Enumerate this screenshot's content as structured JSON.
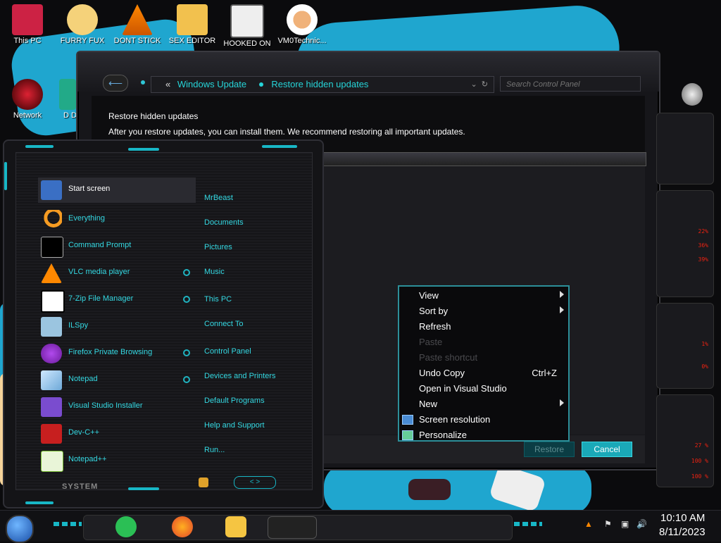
{
  "desktop": {
    "icons": [
      {
        "label": "This PC",
        "icon": "this-pc-icon"
      },
      {
        "label": "FURRY FUX",
        "icon": "cartoon-icon"
      },
      {
        "label": "DONT STICK",
        "icon": "vlc-cone-icon"
      },
      {
        "label": "SEX EDITOR",
        "icon": "hxd-editor-icon"
      },
      {
        "label": "HOOKED ON",
        "icon": "maze-app-icon"
      },
      {
        "label": "VM0Technic...",
        "icon": "doctor-user-icon"
      },
      {
        "label": "Network",
        "icon": "network-icon"
      },
      {
        "label": "D DUM",
        "icon": "partial-icon"
      }
    ]
  },
  "control_panel": {
    "breadcrumb": [
      "Windows Update",
      "Restore hidden updates"
    ],
    "breadcrumb_prefix": "«",
    "search_placeholder": "Search Control Panel",
    "heading": "Restore hidden updates",
    "description": "After you restore updates, you can install them. We recommend restoring all important updates.",
    "buttons": {
      "restore": "Restore",
      "cancel": "Cancel"
    }
  },
  "start_menu": {
    "programs": [
      {
        "label": "Start screen",
        "icon": "start-screen-icon",
        "selected": true,
        "has_jump": false
      },
      {
        "label": "Everything",
        "icon": "magnifier-icon",
        "selected": false,
        "has_jump": false
      },
      {
        "label": "Command Prompt",
        "icon": "cmd-icon",
        "selected": false,
        "has_jump": false
      },
      {
        "label": "VLC media player",
        "icon": "vlc-icon",
        "selected": false,
        "has_jump": true
      },
      {
        "label": "7-Zip File Manager",
        "icon": "7zip-icon",
        "selected": false,
        "has_jump": true
      },
      {
        "label": "ILSpy",
        "icon": "ilspy-icon",
        "selected": false,
        "has_jump": false
      },
      {
        "label": "Firefox Private Browsing",
        "icon": "firefox-private-icon",
        "selected": false,
        "has_jump": true
      },
      {
        "label": "Notepad",
        "icon": "notepad-icon",
        "selected": false,
        "has_jump": true
      },
      {
        "label": "Visual Studio Installer",
        "icon": "vs-installer-icon",
        "selected": false,
        "has_jump": false
      },
      {
        "label": "Dev-C++",
        "icon": "devcpp-icon",
        "selected": false,
        "has_jump": false
      },
      {
        "label": "Notepad++",
        "icon": "notepadpp-icon",
        "selected": false,
        "has_jump": false
      }
    ],
    "places": [
      "MrBeast",
      "Documents",
      "Pictures",
      "Music",
      "This PC",
      "Connect To",
      "Control Panel",
      "Devices and Printers",
      "Default Programs",
      "Help and Support",
      "Run..."
    ],
    "footer_label": "SYSTEM",
    "nav_arrows": "< >"
  },
  "context_menu": {
    "items": [
      {
        "label": "View",
        "shortcut": "",
        "submenu": true,
        "disabled": false,
        "icon": ""
      },
      {
        "label": "Sort by",
        "shortcut": "",
        "submenu": true,
        "disabled": false,
        "icon": ""
      },
      {
        "label": "Refresh",
        "shortcut": "",
        "submenu": false,
        "disabled": false,
        "icon": ""
      },
      {
        "label": "Paste",
        "shortcut": "",
        "submenu": false,
        "disabled": true,
        "icon": ""
      },
      {
        "label": "Paste shortcut",
        "shortcut": "",
        "submenu": false,
        "disabled": true,
        "icon": ""
      },
      {
        "label": "Undo Copy",
        "shortcut": "Ctrl+Z",
        "submenu": false,
        "disabled": false,
        "icon": ""
      },
      {
        "label": "Open in Visual Studio",
        "shortcut": "",
        "submenu": false,
        "disabled": false,
        "icon": ""
      },
      {
        "label": "New",
        "shortcut": "",
        "submenu": true,
        "disabled": false,
        "icon": ""
      },
      {
        "label": "Screen resolution",
        "shortcut": "",
        "submenu": false,
        "disabled": false,
        "icon": "display-icon"
      },
      {
        "label": "Personalize",
        "shortcut": "",
        "submenu": false,
        "disabled": false,
        "icon": "personalize-icon"
      }
    ]
  },
  "taskbar": {
    "apps": [
      "feedback-hub-icon",
      "firefox-icon",
      "file-explorer-icon",
      "alienware-app-icon"
    ],
    "time": "10:10 AM",
    "date": "8/11/2023"
  },
  "gadget_values": [
    "22%",
    "36%",
    "39%",
    "1%",
    "0%",
    "27 %",
    "100 %",
    "100 %"
  ],
  "colors": {
    "accent": "#18b7c6",
    "text_accent": "#34d8e2",
    "alert": "#e21111"
  }
}
